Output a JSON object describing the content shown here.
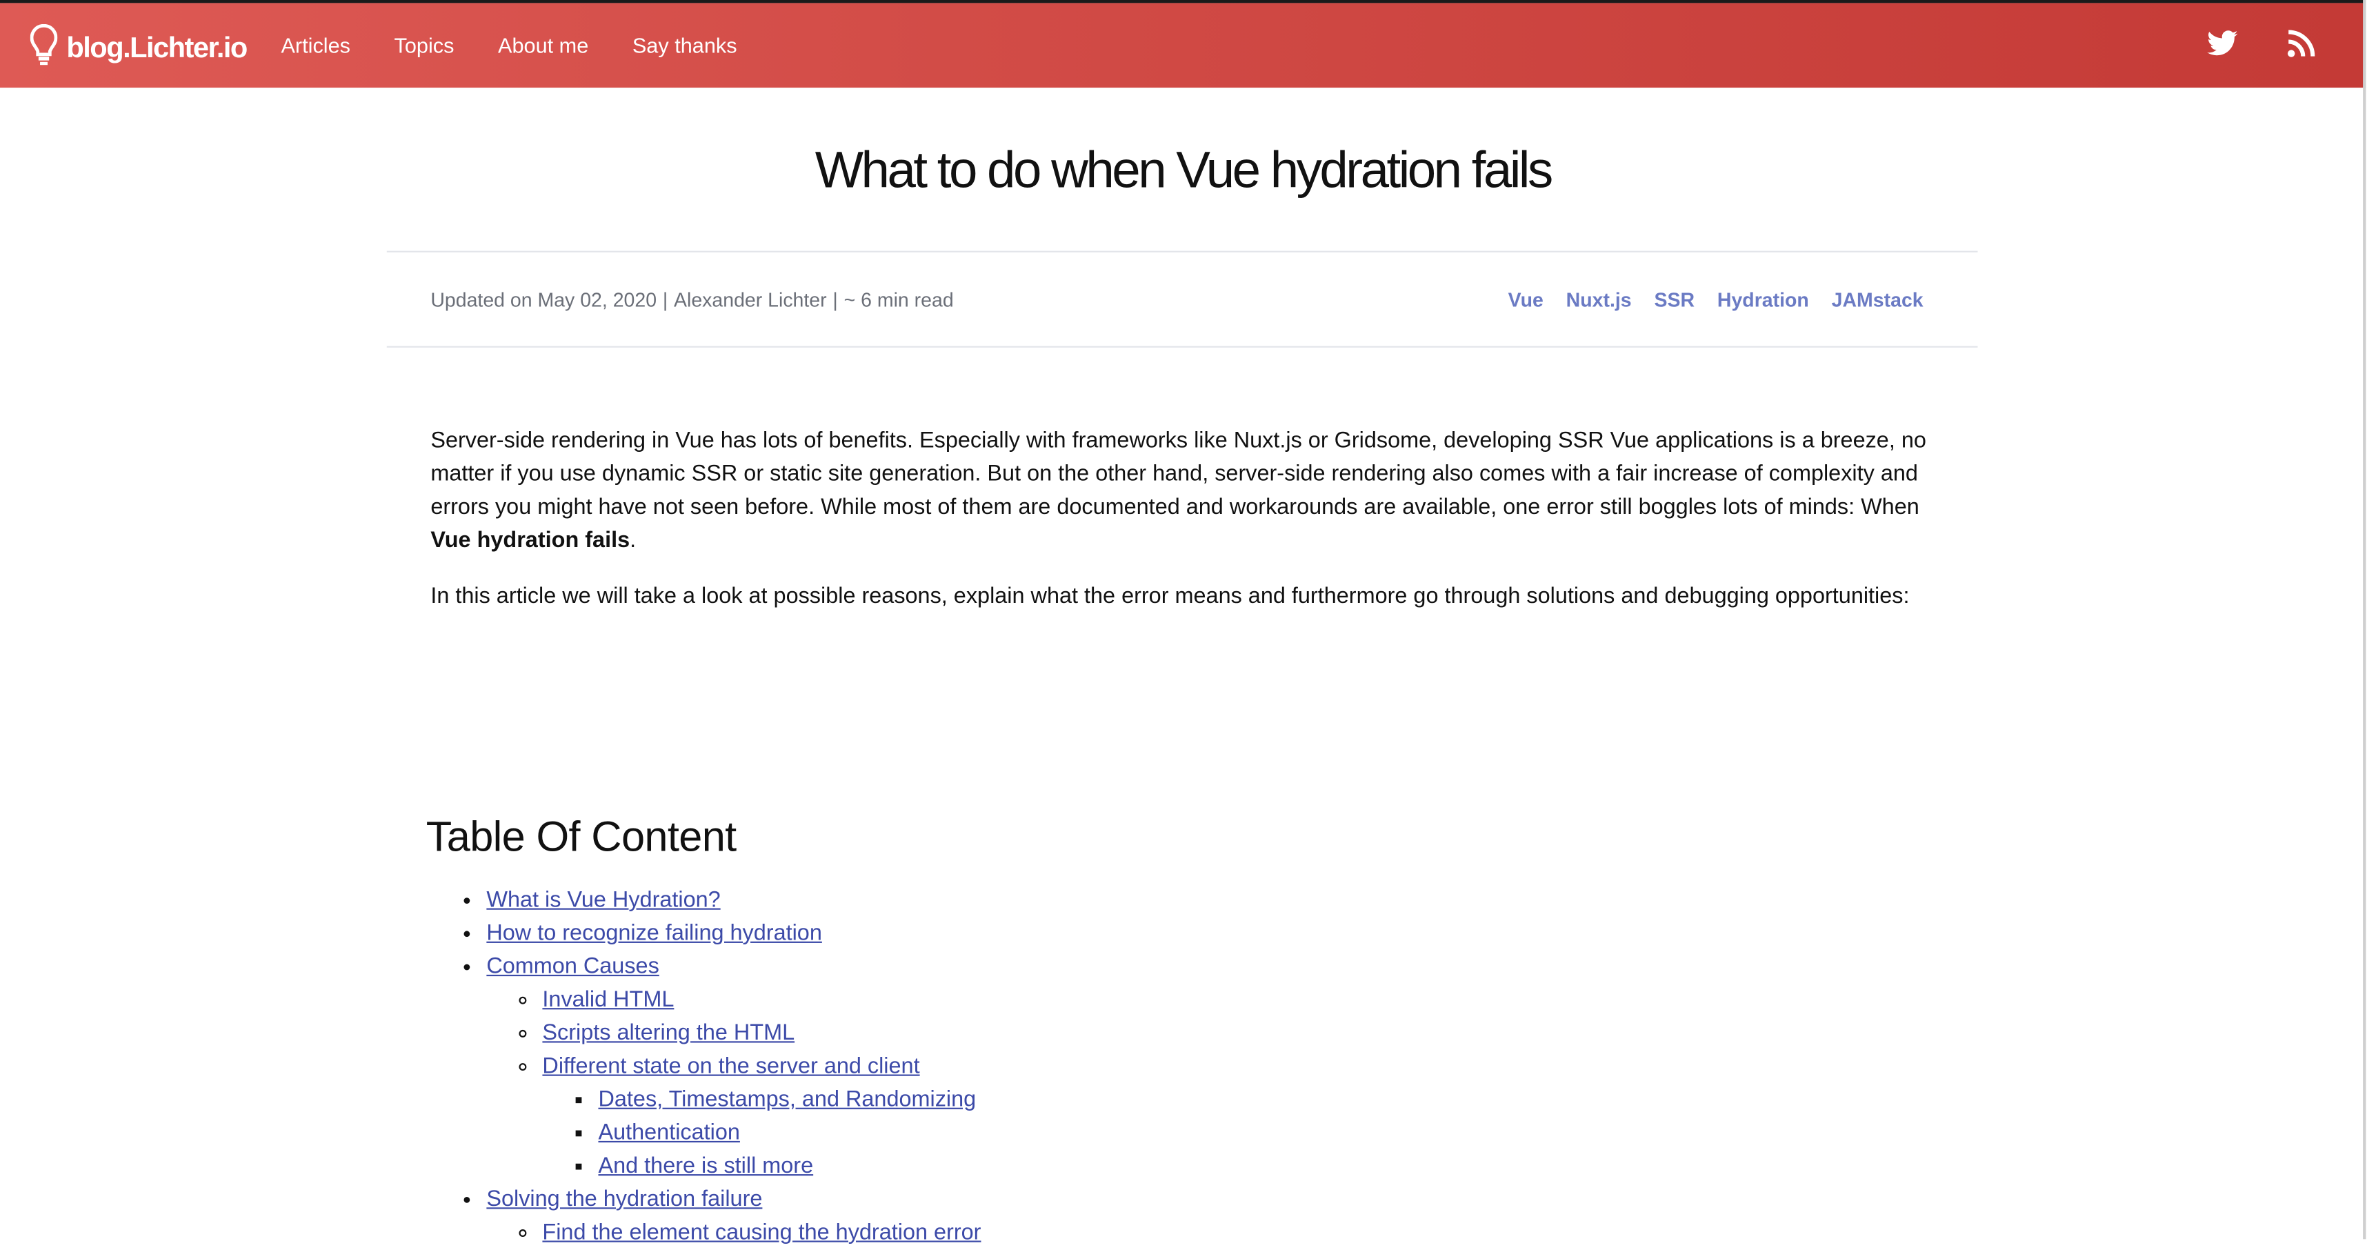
{
  "header": {
    "brand": "blog.Lichter.io",
    "nav": [
      "Articles",
      "Topics",
      "About me",
      "Say thanks"
    ]
  },
  "article": {
    "title": "What to do when Vue hydration fails",
    "meta": {
      "updated": "Updated on May 02, 2020",
      "author": "Alexander Lichter",
      "read_time": "~ 6 min read"
    },
    "tags": [
      "Vue",
      "Nuxt.js",
      "SSR",
      "Hydration",
      "JAMstack"
    ],
    "intro_1": "Server-side rendering in Vue has lots of benefits. Especially with frameworks like Nuxt.js or Gridsome, developing SSR Vue applications is a breeze, no matter if you use dynamic SSR or static site generation. But on the other hand, server-side rendering also comes with a fair increase of complexity and errors you might have not seen before. While most of them are documented and workarounds are available, one error still boggles lots of minds: When ",
    "intro_1_bold": "Vue hydration fails",
    "intro_1_end": ".",
    "intro_2": "In this article we will take a look at possible reasons, explain what the error means and furthermore go through solutions and debugging opportunities:"
  },
  "toc": {
    "title": "Table Of Content",
    "items": [
      "What is Vue Hydration?",
      "How to recognize failing hydration",
      "Common Causes",
      "Invalid HTML",
      "Scripts altering the HTML",
      "Different state on the server and client",
      "Dates, Timestamps, and Randomizing",
      "Authentication",
      "And there is still more",
      "Solving the hydration failure",
      "Find the element causing the hydration error"
    ]
  },
  "colors": {
    "header": "#d24c47",
    "tag": "#6b7bc4",
    "link": "#3c4aa8"
  },
  "icons": [
    "lightbulb-icon",
    "twitter-icon",
    "rss-icon"
  ]
}
